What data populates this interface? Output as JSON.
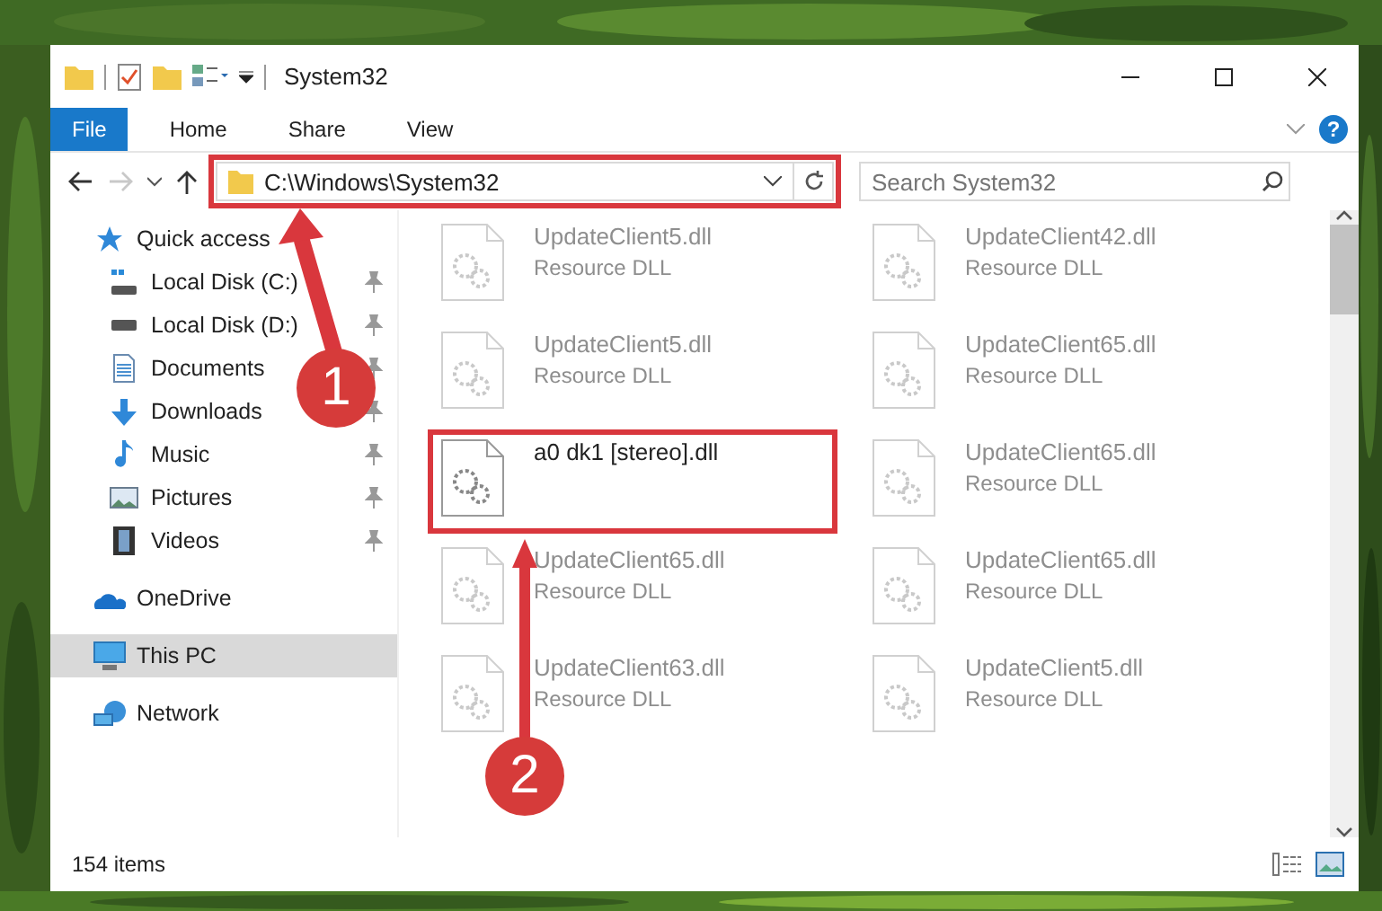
{
  "window": {
    "title": "System32"
  },
  "ribbon": {
    "tabs": [
      {
        "label": "File",
        "selected": true
      },
      {
        "label": "Home",
        "selected": false
      },
      {
        "label": "Share",
        "selected": false
      },
      {
        "label": "View",
        "selected": false
      }
    ],
    "help": "?"
  },
  "navigation": {
    "back_disabled": false,
    "forward_disabled": true
  },
  "address": {
    "path": "C:\\Windows\\System32",
    "framed": true
  },
  "search": {
    "placeholder": "Search System32"
  },
  "sidebar": {
    "items": [
      {
        "label": "Quick access",
        "selected": false,
        "children": [
          {
            "label": "Local Disk (C:)",
            "pinned": true,
            "selected": false
          },
          {
            "label": "Local Disk (D:)",
            "pinned": true,
            "selected": false
          },
          {
            "label": "Documents",
            "pinned": true,
            "selected": false
          },
          {
            "label": "Downloads",
            "pinned": true,
            "selected": false
          },
          {
            "label": "Music",
            "pinned": true,
            "selected": false
          },
          {
            "label": "Pictures",
            "pinned": true,
            "selected": false
          },
          {
            "label": "Videos",
            "pinned": true,
            "selected": false
          }
        ]
      },
      {
        "label": "OneDrive",
        "selected": false
      },
      {
        "label": "This PC",
        "selected": true
      },
      {
        "label": "Network",
        "selected": false
      }
    ]
  },
  "files": [
    {
      "name": "UpdateClient5.dll",
      "type": "Resource DLL",
      "blurred": true,
      "framed": false
    },
    {
      "name": "UpdateClient42.dll",
      "type": "Resource DLL",
      "blurred": true,
      "framed": false
    },
    {
      "name": "UpdateClient5.dll",
      "type": "Resource DLL",
      "blurred": true,
      "framed": false
    },
    {
      "name": "UpdateClient65.dll",
      "type": "Resource DLL",
      "blurred": true,
      "framed": false
    },
    {
      "name": "a0 dk1 [stereo].dll",
      "blurred": false,
      "framed": true
    },
    {
      "name": "UpdateClient65.dll",
      "type": "Resource DLL",
      "blurred": true,
      "framed": false
    },
    {
      "name": "UpdateClient65.dll",
      "type": "Resource DLL",
      "blurred": true,
      "framed": false
    },
    {
      "name": "UpdateClient65.dll",
      "type": "Resource DLL",
      "blurred": true,
      "framed": false
    },
    {
      "name": "UpdateClient63.dll",
      "type": "Resource DLL",
      "blurred": true,
      "framed": false
    },
    {
      "name": "UpdateClient5.dll",
      "type": "Resource DLL",
      "blurred": true,
      "framed": false
    }
  ],
  "status_bar": {
    "count": "154 items"
  },
  "annotations": [
    {
      "number": "1"
    },
    {
      "number": "2"
    }
  ]
}
